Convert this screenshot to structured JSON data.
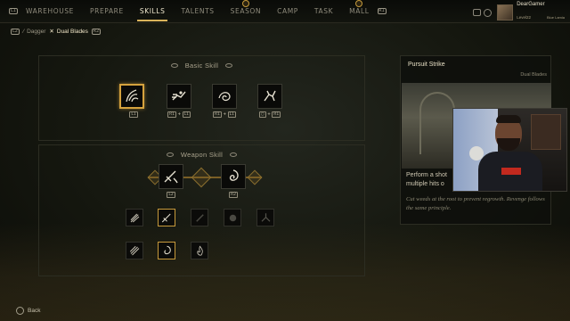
{
  "nav": {
    "left_hint": "L1",
    "right_hint": "R1",
    "tabs": [
      "WAREHOUSE",
      "PREPARE",
      "SKILLS",
      "TALENTS",
      "SEASON",
      "CAMP",
      "TASK",
      "MALL"
    ],
    "active_tab": "SKILLS"
  },
  "user": {
    "name": "DearGamer",
    "level": "Level22",
    "guild": "Blue Lamia"
  },
  "weapons": {
    "left_hint": "L2",
    "right_hint": "R2",
    "items": [
      "Dagger",
      "Dual Blades"
    ],
    "active": "Dual Blades"
  },
  "basic": {
    "title": "Basic Skill",
    "skills": [
      {
        "icon": "tendril-icon",
        "keys": [
          "L1"
        ]
      },
      {
        "icon": "dash-strike-icon",
        "keys": [
          "R1",
          "+",
          "L1"
        ]
      },
      {
        "icon": "spiral-slash-icon",
        "keys": [
          "R1",
          "+",
          "L1"
        ]
      },
      {
        "icon": "leap-icon",
        "keys": [
          "○",
          "+",
          "R1"
        ]
      }
    ]
  },
  "weapon_skill": {
    "title": "Weapon Skill",
    "active": [
      {
        "icon": "pursuit-strike-icon",
        "key": "L2"
      },
      {
        "icon": "whirl-icon",
        "key": "R2"
      }
    ],
    "row1": [
      "claw-icon",
      "pursuit-strike-icon",
      "shadow-icon",
      "burst-icon",
      "split-icon"
    ],
    "row2": [
      "triple-slash-icon",
      "whirl-icon",
      "flame-icon"
    ]
  },
  "detail": {
    "title": "Pursuit Strike",
    "weapon": "Dual Blades",
    "desc": "Perform a shot multiple hits o",
    "quote": "Cut weeds at the root to prevent regrowth. Revenge follows the same principle."
  },
  "footer": {
    "back": "Back"
  },
  "colors": {
    "accent": "#d9b35b",
    "selected": "#d5a23e"
  }
}
